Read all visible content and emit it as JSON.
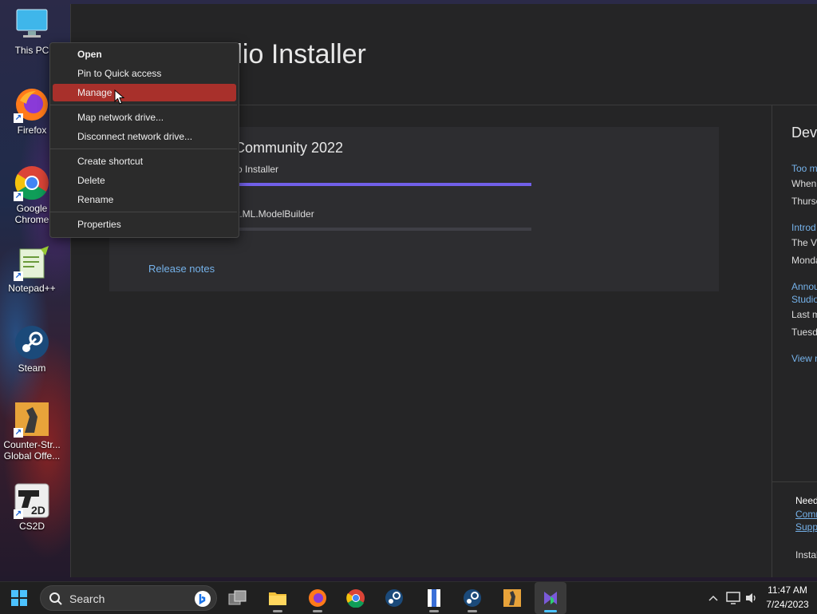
{
  "desktop": {
    "icons": [
      {
        "label": "This PC",
        "icon": "monitor-icon"
      },
      {
        "label": "Firefox",
        "icon": "firefox-icon"
      },
      {
        "label": "Google Chrome",
        "icon": "chrome-icon"
      },
      {
        "label": "Notepad++",
        "icon": "notepadpp-icon"
      },
      {
        "label": "Steam",
        "icon": "steam-icon"
      },
      {
        "label": "Counter-Str... Global Offe...",
        "icon": "csgo-icon"
      },
      {
        "label": "CS2D",
        "icon": "cs2d-icon"
      }
    ]
  },
  "installer": {
    "title": "dio Installer",
    "product": {
      "name": "Community 2022",
      "status": "o Installer",
      "package": "t.ML.ModelBuilder",
      "progress_main": 1.0,
      "progress_package": 0.0
    },
    "release_notes": "Release notes",
    "side": {
      "title": "Deve",
      "items": [
        {
          "link": "Too m",
          "text1": "When",
          "text2": "Thursc"
        },
        {
          "link": "Introd",
          "text1": "The Vi",
          "text2": "Monda"
        },
        {
          "link": "Annou",
          "link2": "Studio",
          "text1": "Last m",
          "text2": "Tuesda"
        }
      ],
      "view_more": "View n",
      "bottom_text": "Need",
      "bottom_link1": "Comr",
      "bottom_link2": "Supp",
      "bottom_text2": "Instal"
    }
  },
  "context_menu": {
    "items": [
      "Open",
      "Pin to Quick access",
      "Manage",
      "Map network drive...",
      "Disconnect network drive...",
      "Create shortcut",
      "Delete",
      "Rename",
      "Properties"
    ],
    "highlighted": "Manage",
    "accent": "#a8302b"
  },
  "taskbar": {
    "search_label": "Search",
    "time": "11:47 AM",
    "date": "7/24/2023"
  }
}
